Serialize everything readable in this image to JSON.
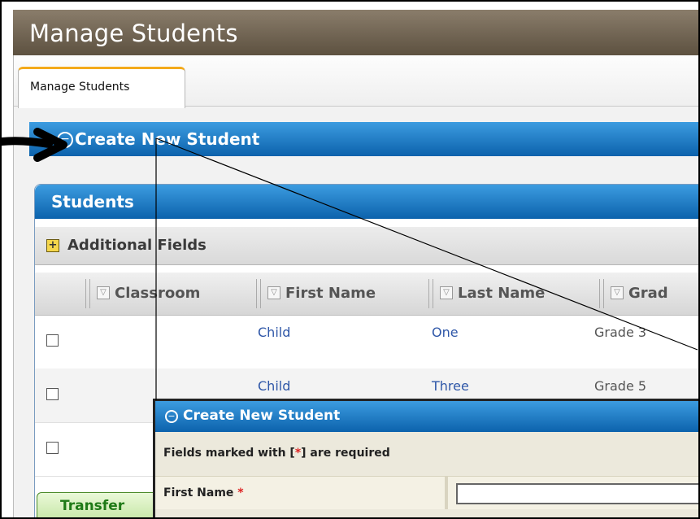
{
  "header": {
    "title": "Manage Students"
  },
  "tabs": [
    {
      "label": "Manage Students"
    }
  ],
  "create_section": {
    "title": "Create New Student"
  },
  "students_panel": {
    "title": "Students",
    "additional_fields_label": "Additional Fields",
    "columns": [
      "Classroom",
      "First Name",
      "Last Name",
      "Grad"
    ],
    "rows": [
      {
        "first_name": "Child",
        "last_name": "One",
        "grade": "Grade 3"
      },
      {
        "first_name": "Child",
        "last_name": "Three",
        "grade": "Grade 5"
      },
      {
        "first_name": "",
        "last_name": "",
        "grade": ""
      }
    ],
    "transfer_button_label": "Transfer"
  },
  "zoom_panel": {
    "title": "Create New Student",
    "required_prefix": "Fields marked with [",
    "required_star": "*",
    "required_suffix": "] are required",
    "field_label": "First Name",
    "field_star": "*",
    "field_value": ""
  },
  "colors": {
    "blue_bar": "#0c62ac",
    "header_brown": "#5d5140",
    "tab_accent": "#f3a91a",
    "link_blue": "#2f57a8"
  },
  "icons": [
    "arrow-icon",
    "collapse-circle-icon",
    "plus-icon",
    "filter-icon",
    "checkbox-icon"
  ]
}
